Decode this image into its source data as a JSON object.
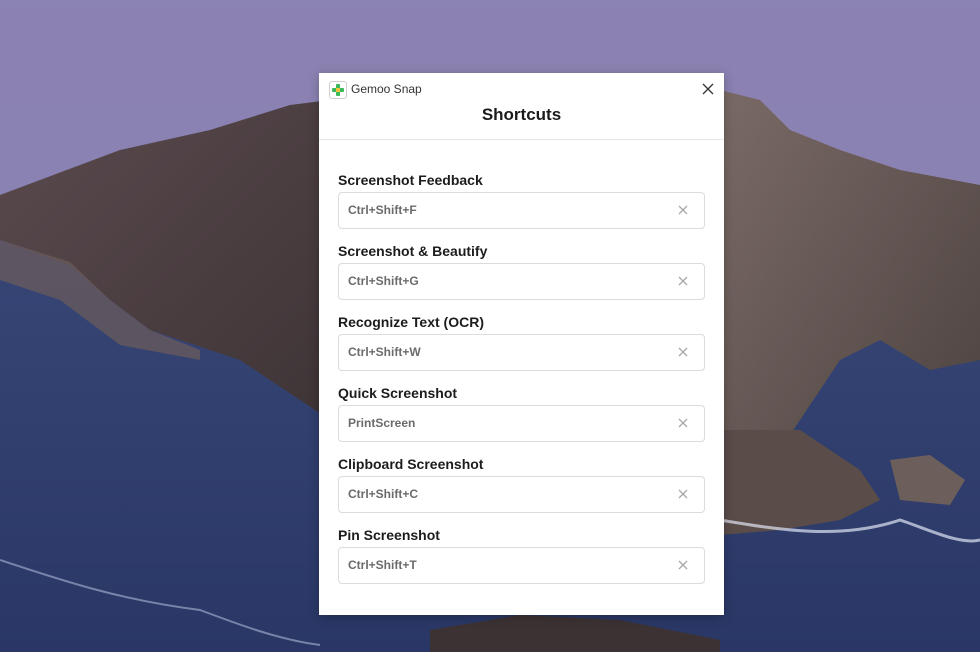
{
  "app": {
    "name": "Gemoo Snap",
    "logo_icon": "plus-logo-icon"
  },
  "window": {
    "title": "Shortcuts"
  },
  "shortcuts": [
    {
      "label": "Screenshot Feedback",
      "keys": "Ctrl+Shift+F"
    },
    {
      "label": "Screenshot & Beautify",
      "keys": "Ctrl+Shift+G"
    },
    {
      "label": "Recognize Text (OCR)",
      "keys": "Ctrl+Shift+W"
    },
    {
      "label": "Quick Screenshot",
      "keys": "PrintScreen"
    },
    {
      "label": "Clipboard Screenshot",
      "keys": "Ctrl+Shift+C"
    },
    {
      "label": "Pin Screenshot",
      "keys": "Ctrl+Shift+T"
    }
  ],
  "colors": {
    "logo_green": "#3cb85a",
    "label_text": "#1c1c1c",
    "value_text": "#6b6b6b",
    "field_border": "#dcdcdc"
  }
}
